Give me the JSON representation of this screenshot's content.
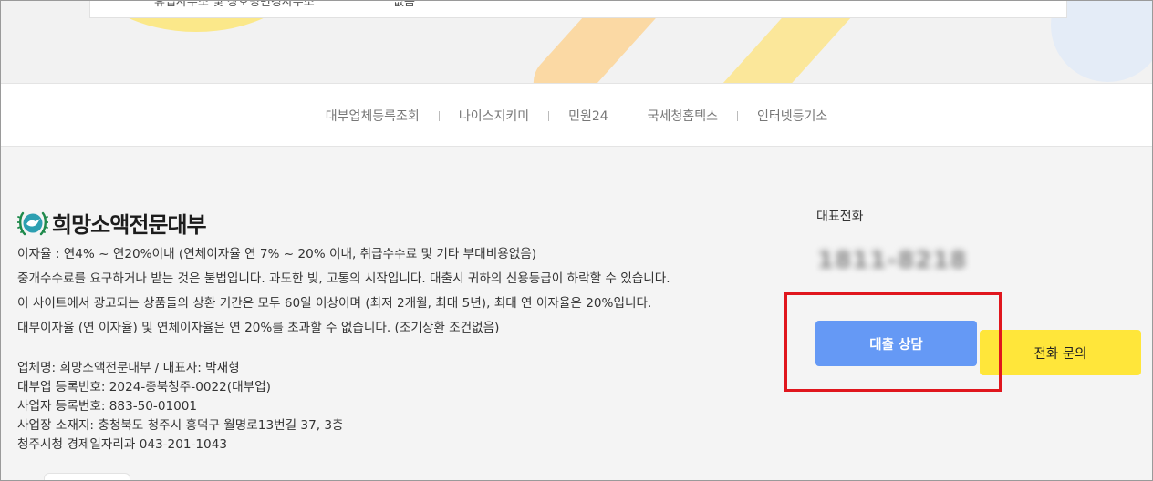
{
  "hero": {
    "card_left_text": "휴업사무소 및 상호명변경사무소",
    "card_right_text": "없음"
  },
  "links": [
    {
      "label": "대부업체등록조회"
    },
    {
      "label": "나이스지키미"
    },
    {
      "label": "민원24"
    },
    {
      "label": "국세청홈텍스"
    },
    {
      "label": "인터넷등기소"
    }
  ],
  "footer": {
    "logo_text": "희망소액전문대부",
    "notice": [
      "이자율 : 연4% ~ 연20%이내 (연체이자율 연 7% ~ 20% 이내, 취급수수료 및 기타 부대비용없음)",
      "중개수수료를 요구하거나 받는 것은 불법입니다. 과도한 빚, 고통의 시작입니다. 대출시 귀하의 신용등급이 하락할 수 있습니다.",
      "이 사이트에서 광고되는 상품들의 상환 기간은 모두 60일 이상이며 (최저 2개월, 최대 5년), 최대 연 이자율은 20%입니다.",
      "대부이자율 (연 이자율) 및 연체이자율은 연 20%를 초과할 수 없습니다. (조기상환 조건없음)"
    ],
    "company": [
      "업체명: 희망소액전문대부 / 대표자: 박재형",
      "대부업 등록번호: 2024-충북청주-0022(대부업)",
      "사업자 등록번호: 883-50-01001",
      "사업장 소재지: 충청북도 청주시 흥덕구 월명로13번길 37, 3층",
      "청주시청 경제일자리과 043-201-1043"
    ],
    "phone_label": "대표전화",
    "phone_number": "1811-8218",
    "loan_button": "대출 상담",
    "call_button": "전화 문의"
  },
  "colors": {
    "loan_button_bg": "#6599f5",
    "call_button_bg": "#ffe63a",
    "highlight": "#e0161d",
    "logo_green": "#1f8a4c",
    "logo_teal": "#2d9fb1"
  },
  "icons": {
    "logo": "dove-emblem-icon"
  }
}
